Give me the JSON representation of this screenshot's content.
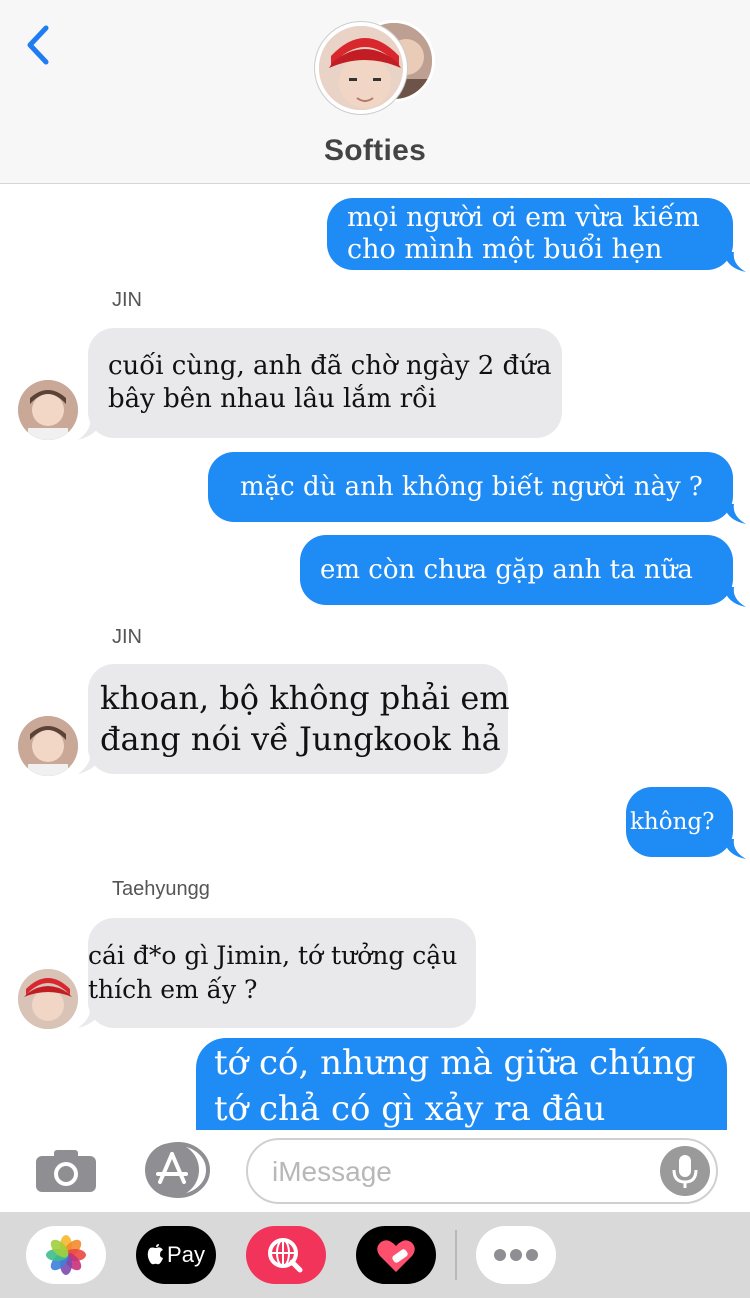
{
  "header": {
    "title": "Softies",
    "back_icon": "chevron-left-icon",
    "accent_color": "#1f7cf2"
  },
  "messages": [
    {
      "direction": "out",
      "lines": [
        "mọi người ơi em vừa kiếm",
        "cho mình một buổi hẹn"
      ]
    },
    {
      "direction": "in",
      "sender": "JIN",
      "lines": [
        "cuối cùng, anh đã chờ ngày 2 đứa",
        "bây bên nhau lâu lắm rồi"
      ]
    },
    {
      "direction": "out",
      "lines": [
        "mặc dù anh không biết người này ?"
      ]
    },
    {
      "direction": "out",
      "lines": [
        "em còn chưa gặp anh ta nữa"
      ]
    },
    {
      "direction": "in",
      "sender": "JIN",
      "lines": [
        "khoan, bộ không phải em",
        "đang nói về Jungkook hả"
      ]
    },
    {
      "direction": "out",
      "lines": [
        "không?"
      ]
    },
    {
      "direction": "in",
      "sender": "Taehyungg",
      "lines": [
        "cái đ*o gì Jimin, tớ tưởng cậu",
        "thích em ấy ?"
      ]
    },
    {
      "direction": "out",
      "lines": [
        "tớ có, nhưng mà giữa chúng",
        "tớ chả có gì xảy ra đâu"
      ]
    }
  ],
  "input": {
    "placeholder": "iMessage",
    "camera_icon": "camera-icon",
    "apps_icon": "app-store-icon",
    "mic_icon": "microphone-icon"
  },
  "drawer": {
    "apps": [
      {
        "name": "photos-app-icon"
      },
      {
        "name": "apple-pay-app",
        "label": "Pay"
      },
      {
        "name": "image-search-app-icon"
      },
      {
        "name": "digital-touch-app-icon"
      },
      {
        "name": "more-apps-icon"
      }
    ]
  },
  "colors": {
    "outgoing_bubble": "#1f8bf5",
    "incoming_bubble": "#e9e9eb",
    "header_bg": "#f7f7f7",
    "drawer_bg": "#d9d9d9"
  }
}
